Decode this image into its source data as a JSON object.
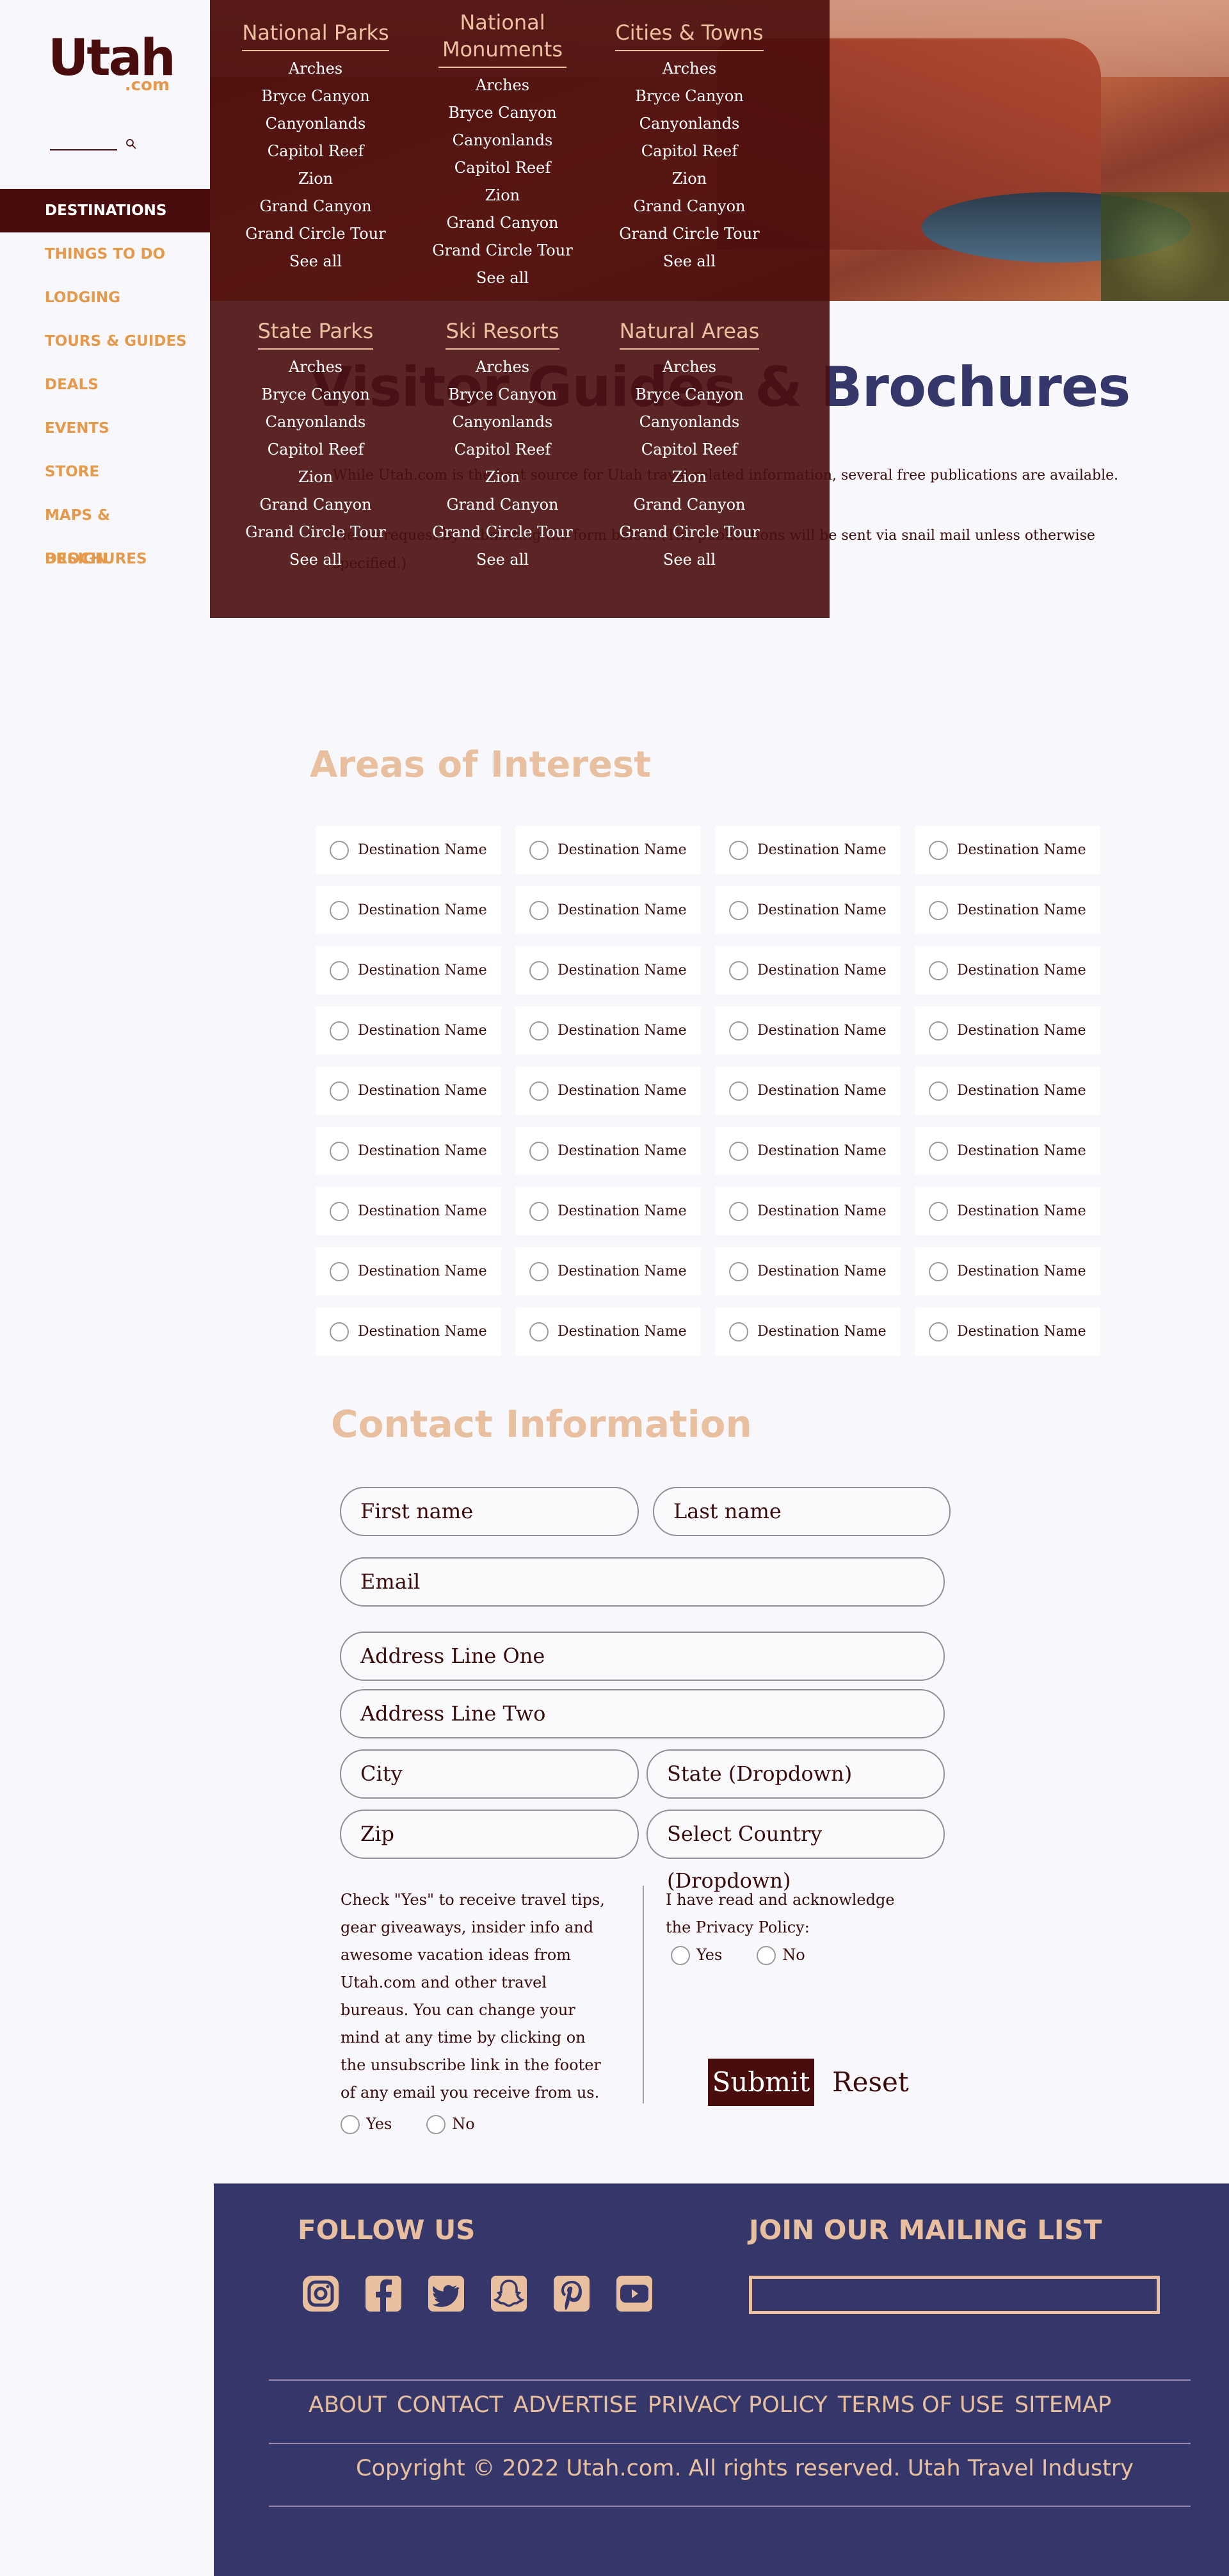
{
  "logo": {
    "main": "Utah",
    "sub": ".com"
  },
  "search": {
    "placeholder": ""
  },
  "nav": [
    {
      "label": "DESTINATIONS"
    },
    {
      "label": "THINGS TO DO"
    },
    {
      "label": "LODGING"
    },
    {
      "label": "TOURS & GUIDES"
    },
    {
      "label": "DEALS"
    },
    {
      "label": "EVENTS"
    },
    {
      "label": "STORE"
    },
    {
      "label": "MAPS & BROCHURES"
    },
    {
      "label": "DESIGN"
    }
  ],
  "mega_menu": [
    {
      "heading": "National Parks",
      "links": [
        "Arches",
        "Bryce Canyon",
        "Canyonlands",
        "Capitol Reef",
        "Zion",
        "Grand Canyon",
        "Grand Circle Tour",
        "See all"
      ]
    },
    {
      "heading": "National Monuments",
      "links": [
        "Arches",
        "Bryce Canyon",
        "Canyonlands",
        "Capitol Reef",
        "Zion",
        "Grand Canyon",
        "Grand Circle Tour",
        "See all"
      ]
    },
    {
      "heading": "Cities & Towns",
      "links": [
        "Arches",
        "Bryce Canyon",
        "Canyonlands",
        "Capitol Reef",
        "Zion",
        "Grand Canyon",
        "Grand Circle Tour",
        "See all"
      ]
    },
    {
      "heading": "State Parks",
      "links": [
        "Arches",
        "Bryce Canyon",
        "Canyonlands",
        "Capitol Reef",
        "Zion",
        "Grand Canyon",
        "Grand Circle Tour",
        "See all"
      ]
    },
    {
      "heading": "Ski Resorts",
      "links": [
        "Arches",
        "Bryce Canyon",
        "Canyonlands",
        "Capitol Reef",
        "Zion",
        "Grand Canyon",
        "Grand Circle Tour",
        "See all"
      ]
    },
    {
      "heading": "Natural Areas",
      "links": [
        "Arches",
        "Bryce Canyon",
        "Canyonlands",
        "Capitol Reef",
        "Zion",
        "Grand Canyon",
        "Grand Circle Tour",
        "See all"
      ]
    }
  ],
  "main": {
    "title": "Visitor Guides & Brochures",
    "intro1": "While Utah.com is the best source for Utah travel-related information, several free publications are available.",
    "intro2": "Please request by submitting the form below. (The publications will be sent via snail mail unless otherwise specified.)"
  },
  "areas": {
    "heading": "Areas of Interest",
    "items": [
      "Destination Name",
      "Destination Name",
      "Destination Name",
      "Destination Name",
      "Destination Name",
      "Destination Name",
      "Destination Name",
      "Destination Name",
      "Destination Name",
      "Destination Name",
      "Destination Name",
      "Destination Name",
      "Destination Name",
      "Destination Name",
      "Destination Name",
      "Destination Name",
      "Destination Name",
      "Destination Name",
      "Destination Name",
      "Destination Name",
      "Destination Name",
      "Destination Name",
      "Destination Name",
      "Destination Name",
      "Destination Name",
      "Destination Name",
      "Destination Name",
      "Destination Name",
      "Destination Name",
      "Destination Name",
      "Destination Name",
      "Destination Name",
      "Destination Name",
      "Destination Name",
      "Destination Name",
      "Destination Name"
    ]
  },
  "contact": {
    "heading": "Contact Information",
    "first_name": "First name",
    "last_name": "Last name",
    "email": "Email",
    "address1": "Address Line One",
    "address2": "Address Line Two",
    "city": "City",
    "state": "State (Dropdown)",
    "zip": "Zip",
    "country": "Select Country (Dropdown)",
    "optin_text": "Check \"Yes\" to receive travel tips, gear giveaways, insider info and awesome vacation ideas from Utah.com and other travel bureaus. You can change your mind at any time by clicking on the unsubscribe link in the footer of any email you receive from us.",
    "privacy_text": "I have read and acknowledge the Privacy Policy:",
    "yes": "Yes",
    "no": "No",
    "submit": "Submit",
    "reset": "Reset"
  },
  "footer": {
    "follow_heading": "FOLLOW US",
    "mailing_heading": "JOIN OUR MAILING LIST",
    "social_icons": [
      "instagram-icon",
      "facebook-icon",
      "twitter-icon",
      "snapchat-icon",
      "pinterest-icon",
      "youtube-icon"
    ],
    "links": [
      "ABOUT",
      "CONTACT",
      "ADVERTISE",
      "PRIVACY POLICY",
      "TERMS OF USE",
      "SITEMAP"
    ],
    "copyright": "Copyright © 2022 Utah.com. All rights reserved. Utah Travel Industry"
  },
  "colors": {
    "brand_dark": "#4a0d0d",
    "accent_orange": "#e59a4b",
    "navy": "#35376a",
    "peach": "#e8c0a0"
  }
}
